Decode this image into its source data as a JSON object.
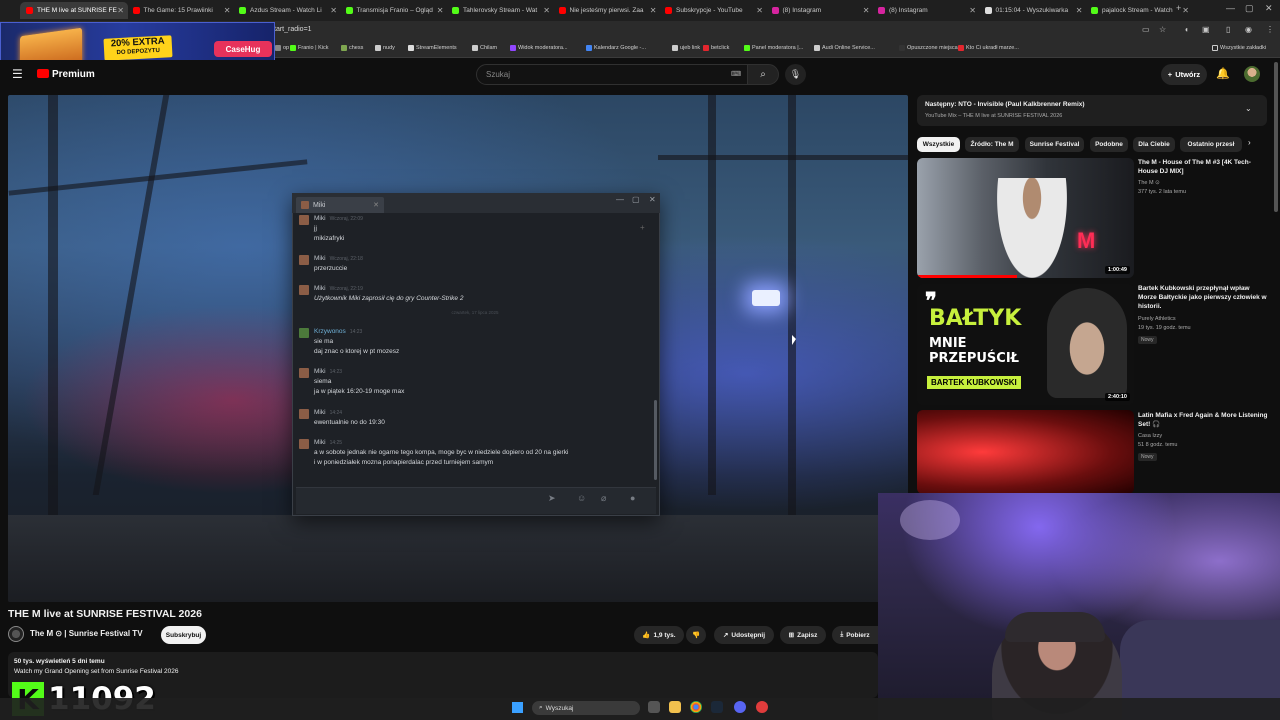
{
  "browser": {
    "tabs": [
      {
        "title": "THE M live at SUNRISE FE",
        "color": "#ff0000",
        "active": true
      },
      {
        "title": "The Game: 15 Prawiinki",
        "color": "#ff0000"
      },
      {
        "title": "Azdus Stream - Watch Li",
        "color": "#53fc18"
      },
      {
        "title": "Transmisja Franio – Ogląd",
        "color": "#53fc18"
      },
      {
        "title": "Tahlerovsky Stream - Wat",
        "color": "#53fc18"
      },
      {
        "title": "Nie jesteśmy pierwsi. Zaa",
        "color": "#ff0000"
      },
      {
        "title": "Subskrypcje - YouTube",
        "color": "#ff0000"
      },
      {
        "title": "(8) Instagram",
        "color": "#d6249f"
      },
      {
        "title": "(8) Instagram",
        "color": "#d6249f"
      },
      {
        "title": "01:15:04 - Wyszukiwarka",
        "color": "#dddddd"
      },
      {
        "title": "pajalock Stream - Watch",
        "color": "#53fc18"
      }
    ],
    "url": "tart_radio=1",
    "bookmarks": [
      {
        "label": "op",
        "color": "#888888"
      },
      {
        "label": "Franio | Kick",
        "color": "#53fc18"
      },
      {
        "label": "chess",
        "color": "#7fa650"
      },
      {
        "label": "nudy",
        "color": "#cccccc"
      },
      {
        "label": "StreamElements",
        "color": "#dddddd"
      },
      {
        "label": "Chilam",
        "color": "#cccccc"
      },
      {
        "label": "Widok moderatora...",
        "color": "#9146ff"
      },
      {
        "label": "Kalendarz Google -...",
        "color": "#4285f4"
      },
      {
        "label": "ujeb link",
        "color": "#cccccc"
      },
      {
        "label": "betclick",
        "color": "#e3262e"
      },
      {
        "label": "Panel moderatora |...",
        "color": "#53fc18"
      },
      {
        "label": "Audi Online Service...",
        "color": "#cccccc"
      },
      {
        "label": "Opuszczone miejsca...",
        "color": "#333333"
      },
      {
        "label": "Kto Ci ukradł marze...",
        "color": "#e3262e"
      }
    ],
    "all_bookmarks": "Wszystkie zakładki"
  },
  "ad": {
    "line1": "20% EXTRA",
    "line2": "DO DEPOZYTU",
    "logo": "CaseHug"
  },
  "youtube": {
    "premium": "Premium",
    "search_placeholder": "Szukaj",
    "create": "Utwórz"
  },
  "chat": {
    "tab_name": "Miki",
    "date_divider": "czwartek, 17 lipca 2025",
    "messages": [
      {
        "name": "Miki",
        "time": "Wczoraj, 22:09",
        "lines": [
          "jj",
          "mikizafryki"
        ],
        "kind": "miki"
      },
      {
        "name": "Miki",
        "time": "Wczoraj, 22:18",
        "lines": [
          "przerzuccie"
        ],
        "kind": "miki"
      },
      {
        "name": "Miki",
        "time": "Wczoraj, 22:19",
        "lines": [
          "Użytkownik Miki zaprosił cię do gry  Counter-Strike 2"
        ],
        "kind": "miki",
        "italic": true
      },
      {
        "name": "Krzywonos",
        "time": "14:23",
        "lines": [
          "sie ma",
          "daj znac o ktorej w pt mozesz"
        ],
        "kind": "kr"
      },
      {
        "name": "Miki",
        "time": "14:23",
        "lines": [
          "siema",
          "ja w piątek 16:20-19 moge max"
        ],
        "kind": "miki"
      },
      {
        "name": "Miki",
        "time": "14:24",
        "lines": [
          "ewentualnie no do 19:30"
        ],
        "kind": "miki"
      },
      {
        "name": "Miki",
        "time": "14:25",
        "lines": [
          "a w sobote jednak nie ogarne tego kompa, moge byc w niedziele dopiero od 20 na gierki",
          "i w poniedziałek mozna ponapierdalac przed turniejem samym"
        ],
        "kind": "miki"
      }
    ]
  },
  "video": {
    "title": "THE M live at SUNRISE FESTIVAL 2026",
    "channel": "The M ⊙ | Sunrise Festival TV",
    "subscribe": "Subskrybuj",
    "likes": "1,9 tys.",
    "share": "Udostępnij",
    "save": "Zapisz",
    "download": "Pobierz",
    "meta": "50 tys. wyświetleń  5 dni temu",
    "description": "Watch my Grand Opening set from Sunrise Festival 2026"
  },
  "kick": {
    "logo": "K",
    "count": "11092"
  },
  "taskbar": {
    "search": "Wyszukaj"
  },
  "sidebar": {
    "next_title": "Następny: NTO - Invisible (Paul Kalkbrenner Remix)",
    "next_sub": "YouTube Mix – THE M live at SUNRISE FESTIVAL 2026",
    "chips": [
      "Wszystkie",
      "Źródło: The M",
      "Sunrise Festival",
      "Podobne",
      "Dla Ciebie",
      "Ostatnio przesł"
    ],
    "videos": [
      {
        "title": "The M - House of The M #3 [4K Tech-House DJ MIX]",
        "channel": "The M ⊙",
        "meta": "377 tys.  2 lata temu",
        "duration": "1:00:49",
        "badge": ""
      },
      {
        "title": "Bartek Kubkowski przepłynął wpław Morze Bałtyckie jako pierwszy człowiek w historii.",
        "channel": "Purely Athletics",
        "meta": "19 tys.  19 godz. temu",
        "duration": "2:40:10",
        "badge": "Nowy"
      },
      {
        "title": "Latin Mafia x Fred Again & More Listening Set! 🎧",
        "channel": "Casa Izzy",
        "meta": "51  8 godz. temu",
        "duration": "",
        "badge": "Nowy"
      }
    ],
    "thumb2": {
      "big": "BAŁTYK",
      "mid": "MNIE PRZEPUŚCIŁ",
      "name": "BARTEK KUBKOWSKI"
    },
    "thumb1_logo": "M"
  }
}
